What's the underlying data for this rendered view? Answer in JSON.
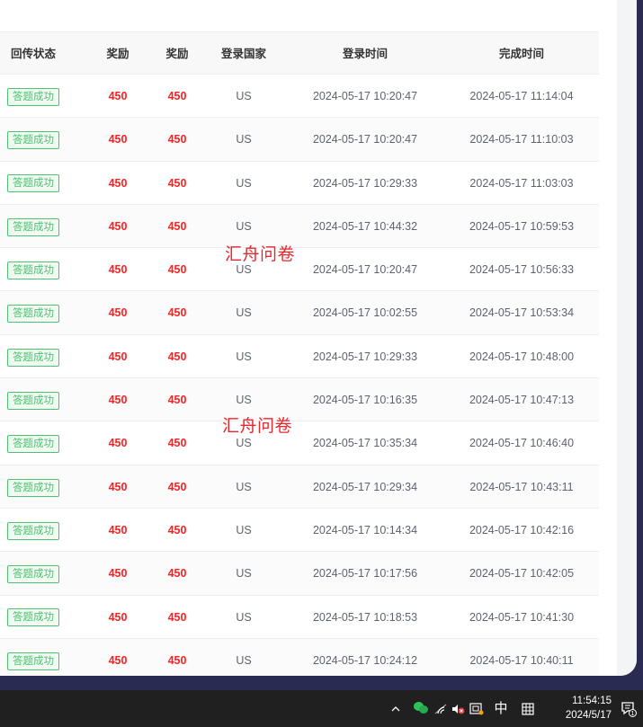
{
  "table": {
    "headers": {
      "status": "回传状态",
      "reward1": "奖励",
      "reward2": "奖励",
      "country": "登录国家",
      "login_time": "登录时间",
      "done_time": "完成时间"
    },
    "rows": [
      {
        "status": "答题成功",
        "reward1": "450",
        "reward2": "450",
        "country": "US",
        "login_time": "2024-05-17 10:20:47",
        "done_time": "2024-05-17 11:14:04"
      },
      {
        "status": "答题成功",
        "reward1": "450",
        "reward2": "450",
        "country": "US",
        "login_time": "2024-05-17 10:20:47",
        "done_time": "2024-05-17 11:10:03"
      },
      {
        "status": "答题成功",
        "reward1": "450",
        "reward2": "450",
        "country": "US",
        "login_time": "2024-05-17 10:29:33",
        "done_time": "2024-05-17 11:03:03"
      },
      {
        "status": "答题成功",
        "reward1": "450",
        "reward2": "450",
        "country": "US",
        "login_time": "2024-05-17 10:44:32",
        "done_time": "2024-05-17 10:59:53"
      },
      {
        "status": "答题成功",
        "reward1": "450",
        "reward2": "450",
        "country": "US",
        "login_time": "2024-05-17 10:20:47",
        "done_time": "2024-05-17 10:56:33"
      },
      {
        "status": "答题成功",
        "reward1": "450",
        "reward2": "450",
        "country": "US",
        "login_time": "2024-05-17 10:02:55",
        "done_time": "2024-05-17 10:53:34"
      },
      {
        "status": "答题成功",
        "reward1": "450",
        "reward2": "450",
        "country": "US",
        "login_time": "2024-05-17 10:29:33",
        "done_time": "2024-05-17 10:48:00"
      },
      {
        "status": "答题成功",
        "reward1": "450",
        "reward2": "450",
        "country": "US",
        "login_time": "2024-05-17 10:16:35",
        "done_time": "2024-05-17 10:47:13"
      },
      {
        "status": "答题成功",
        "reward1": "450",
        "reward2": "450",
        "country": "US",
        "login_time": "2024-05-17 10:35:34",
        "done_time": "2024-05-17 10:46:40"
      },
      {
        "status": "答题成功",
        "reward1": "450",
        "reward2": "450",
        "country": "US",
        "login_time": "2024-05-17 10:29:34",
        "done_time": "2024-05-17 10:43:11"
      },
      {
        "status": "答题成功",
        "reward1": "450",
        "reward2": "450",
        "country": "US",
        "login_time": "2024-05-17 10:14:34",
        "done_time": "2024-05-17 10:42:16"
      },
      {
        "status": "答题成功",
        "reward1": "450",
        "reward2": "450",
        "country": "US",
        "login_time": "2024-05-17 10:17:56",
        "done_time": "2024-05-17 10:42:05"
      },
      {
        "status": "答题成功",
        "reward1": "450",
        "reward2": "450",
        "country": "US",
        "login_time": "2024-05-17 10:18:53",
        "done_time": "2024-05-17 10:41:30"
      },
      {
        "status": "答题成功",
        "reward1": "450",
        "reward2": "450",
        "country": "US",
        "login_time": "2024-05-17 10:24:12",
        "done_time": "2024-05-17 10:40:11"
      }
    ]
  },
  "watermarks": [
    "汇舟问卷",
    "汇舟问卷"
  ],
  "taskbar": {
    "ime": "中",
    "time": "11:54:15",
    "date": "2024/5/17",
    "notification_count": "1",
    "icons": [
      "chevron-up-icon",
      "wechat-icon",
      "wifi-icon",
      "volume-muted-icon",
      "screenshot-app-icon",
      "ime-mode-icon",
      "notification-icon"
    ]
  },
  "colors": {
    "reward_red": "#ff1e1e",
    "tag_green": "#4cc46f",
    "taskbar_bg": "#202020",
    "desktop_bg": "#2a2b52"
  }
}
